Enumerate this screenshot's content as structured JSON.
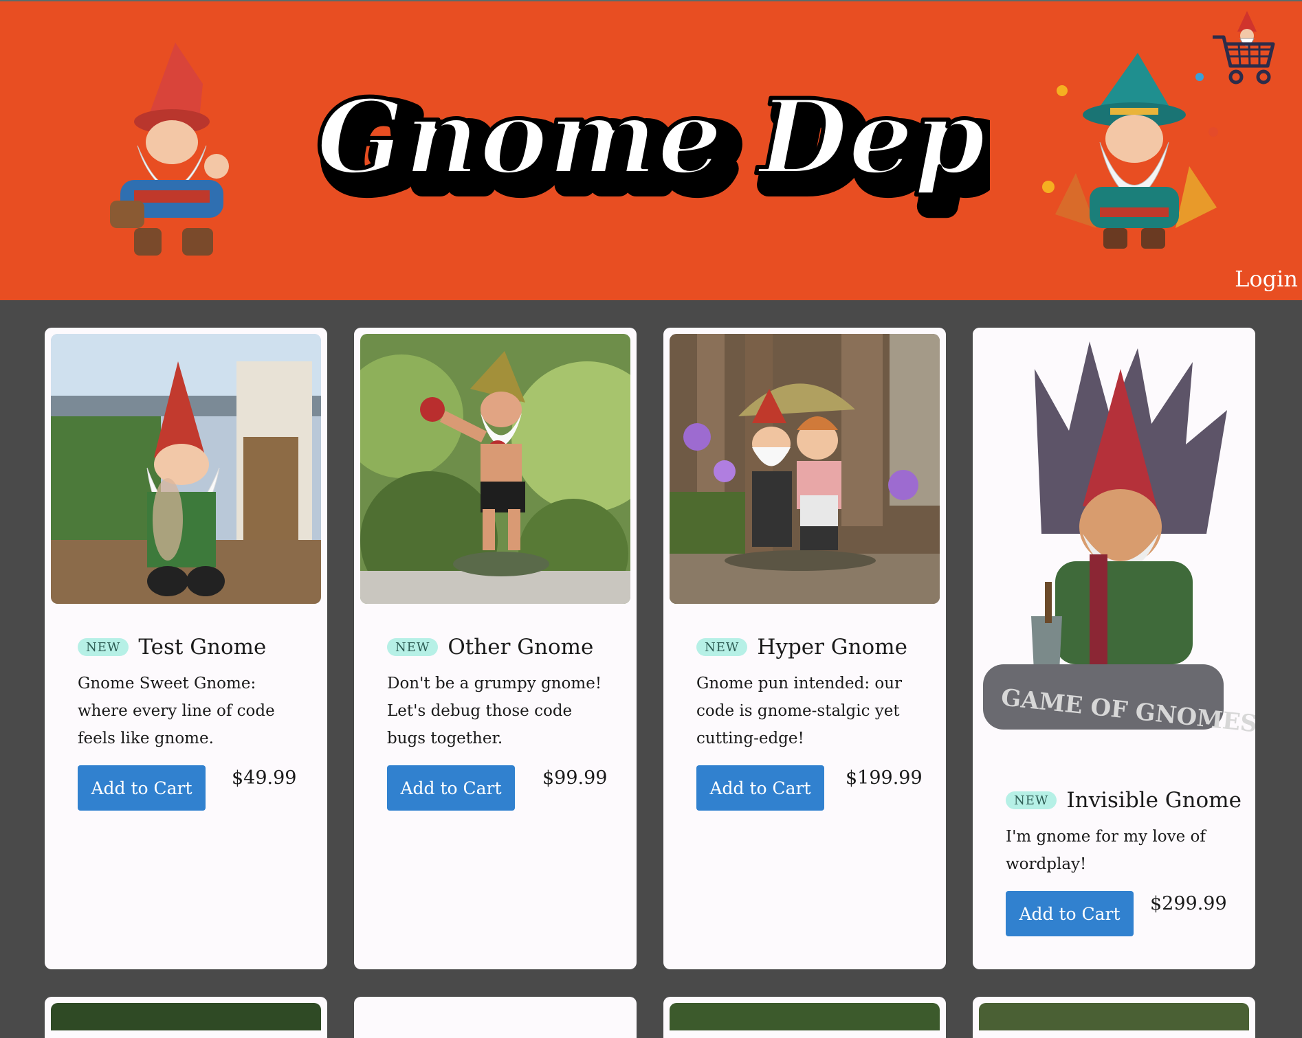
{
  "header": {
    "logo_text": "Gnome Depot",
    "login_label": "Login",
    "cart_icon": "cart-icon"
  },
  "colors": {
    "header_bg": "#e84e22",
    "page_bg": "#4a4a4a",
    "card_bg": "#fdfafd",
    "button_bg": "#3181cf",
    "badge_bg": "#b6f0e6"
  },
  "products": [
    {
      "badge": "NEW",
      "name": "Test Gnome",
      "description": "Gnome Sweet Gnome: where every line of code feels like gnome.",
      "button": "Add to Cart",
      "price": "$49.99"
    },
    {
      "badge": "NEW",
      "name": "Other Gnome",
      "description": "Don't be a grumpy gnome! Let's debug those code bugs together.",
      "button": "Add to Cart",
      "price": "$99.99"
    },
    {
      "badge": "NEW",
      "name": "Hyper Gnome",
      "description": "Gnome pun intended: our code is gnome-stalgic yet cutting-edge!",
      "button": "Add to Cart",
      "price": "$199.99"
    },
    {
      "badge": "NEW",
      "name": "Invisible Gnome",
      "description": "I'm gnome for my love of wordplay!",
      "button": "Add to Cart",
      "price": "$299.99"
    }
  ]
}
